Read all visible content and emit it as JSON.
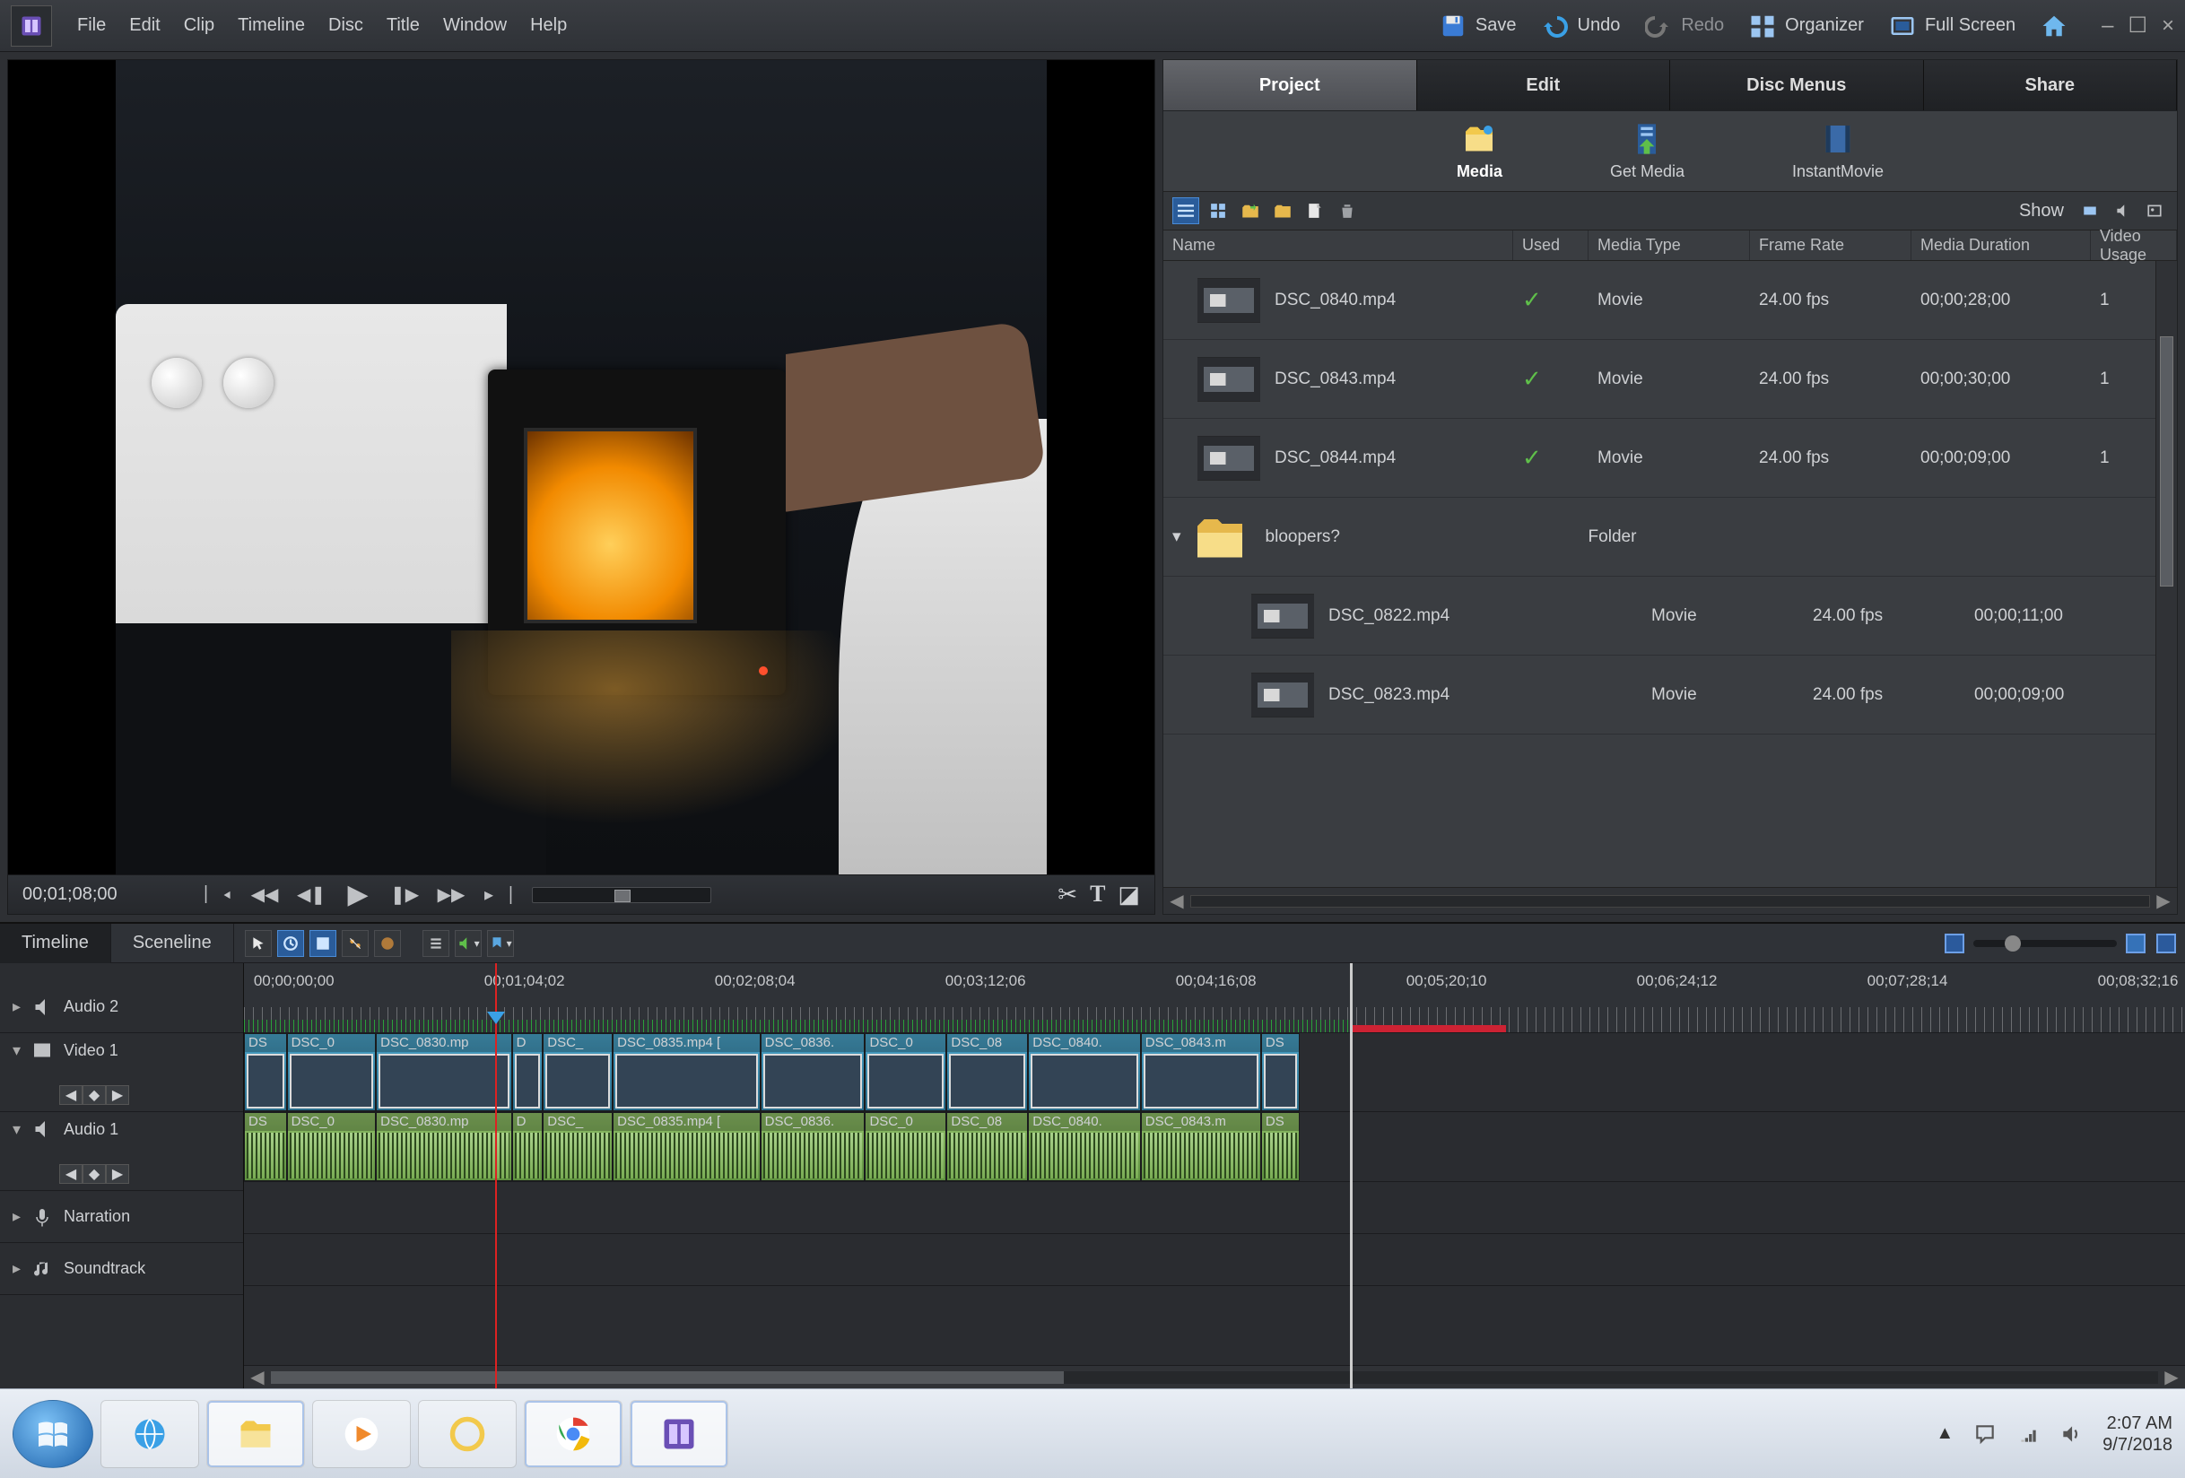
{
  "menu": {
    "file": "File",
    "edit": "Edit",
    "clip": "Clip",
    "timeline": "Timeline",
    "disc": "Disc",
    "title": "Title",
    "window": "Window",
    "help": "Help"
  },
  "topbar": {
    "save": "Save",
    "undo": "Undo",
    "redo": "Redo",
    "organizer": "Organizer",
    "fullscreen": "Full Screen"
  },
  "playback": {
    "timecode": "00;01;08;00"
  },
  "panel": {
    "tabs": {
      "project": "Project",
      "edit": "Edit",
      "disc": "Disc Menus",
      "share": "Share"
    },
    "strip": {
      "media": "Media",
      "get": "Get Media",
      "instant": "InstantMovie"
    },
    "toolbar": {
      "show": "Show"
    },
    "columns": {
      "name": "Name",
      "used": "Used",
      "type": "Media Type",
      "fps": "Frame Rate",
      "dur": "Media Duration",
      "usage": "Video Usage"
    },
    "rows": [
      {
        "name": "DSC_0840.mp4",
        "used": "✓",
        "type": "Movie",
        "fps": "24.00 fps",
        "dur": "00;00;28;00",
        "usage": "1",
        "indent": false,
        "folder": false
      },
      {
        "name": "DSC_0843.mp4",
        "used": "✓",
        "type": "Movie",
        "fps": "24.00 fps",
        "dur": "00;00;30;00",
        "usage": "1",
        "indent": false,
        "folder": false
      },
      {
        "name": "DSC_0844.mp4",
        "used": "✓",
        "type": "Movie",
        "fps": "24.00 fps",
        "dur": "00;00;09;00",
        "usage": "1",
        "indent": false,
        "folder": false
      },
      {
        "name": "bloopers?",
        "used": "",
        "type": "Folder",
        "fps": "",
        "dur": "",
        "usage": "",
        "indent": false,
        "folder": true
      },
      {
        "name": "DSC_0822.mp4",
        "used": "",
        "type": "Movie",
        "fps": "24.00 fps",
        "dur": "00;00;11;00",
        "usage": "",
        "indent": true,
        "folder": false
      },
      {
        "name": "DSC_0823.mp4",
        "used": "",
        "type": "Movie",
        "fps": "24.00 fps",
        "dur": "00;00;09;00",
        "usage": "",
        "indent": true,
        "folder": false
      }
    ]
  },
  "timeline": {
    "modes": {
      "timeline": "Timeline",
      "sceneline": "Sceneline"
    },
    "ruler_labels": [
      "00;00;00;00",
      "00;01;04;02",
      "00;02;08;04",
      "00;03;12;06",
      "00;04;16;08",
      "00;05;20;10",
      "00;06;24;12",
      "00;07;28;14",
      "00;08;32;16"
    ],
    "tracks": {
      "audio2": "Audio 2",
      "video1": "Video 1",
      "audio1": "Audio 1",
      "narration": "Narration",
      "soundtrack": "Soundtrack"
    },
    "clips": [
      {
        "label": "DS",
        "left": 0,
        "width": 2.2
      },
      {
        "label": "DSC_0",
        "left": 2.2,
        "width": 4.6
      },
      {
        "label": "DSC_0830.mp",
        "left": 6.8,
        "width": 7.0
      },
      {
        "label": "D",
        "left": 13.8,
        "width": 1.6
      },
      {
        "label": "DSC_",
        "left": 15.4,
        "width": 3.6
      },
      {
        "label": "DSC_0835.mp4 [",
        "left": 19.0,
        "width": 7.6
      },
      {
        "label": "DSC_0836.",
        "left": 26.6,
        "width": 5.4
      },
      {
        "label": "DSC_0",
        "left": 32.0,
        "width": 4.2
      },
      {
        "label": "DSC_08",
        "left": 36.2,
        "width": 4.2
      },
      {
        "label": "DSC_0840.",
        "left": 40.4,
        "width": 5.8
      },
      {
        "label": "DSC_0843.m",
        "left": 46.2,
        "width": 6.2
      },
      {
        "label": "DS",
        "left": 52.4,
        "width": 2.0
      }
    ]
  },
  "taskbar": {
    "time": "2:07 AM",
    "date": "9/7/2018"
  }
}
